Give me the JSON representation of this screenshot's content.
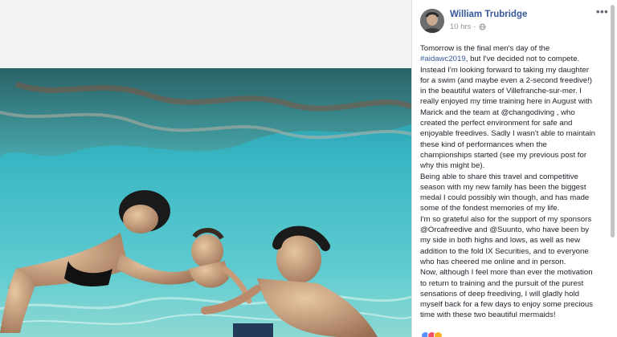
{
  "post": {
    "author_name": "William Trubridge",
    "timestamp": "10 hrs",
    "separator": "·",
    "hashtag": "#aidawc2019",
    "lines": [
      "Tomorrow is the final men's day of the",
      ", but I've decided not to compete.",
      "Instead I'm looking forward to taking my daughter",
      "for a swim (and maybe even a 2-second freedive!)",
      "in the beautiful waters of Villefranche-sur-mer. I",
      "really enjoyed my time training here in August with",
      "Marick and the team at @changodiving , who",
      "created the perfect environment for safe and",
      "enjoyable freedives. Sadly I wasn't able to maintain",
      "these kind of performances when the",
      "championships started (see my previous post for",
      "why this might be).",
      "Being able to share this travel and competitive",
      "season with my new family has been the biggest",
      "medal I could possibly win though, and has made",
      "some of the fondest memories of my life.",
      "I'm so grateful also for the support of my sponsors",
      "@Orcafreedive and @Suunto, who have been by",
      "my side in both highs and lows, as well as new",
      "addition to the fold IX Securities, and to everyone",
      "who has cheered me online and in person.",
      "Now, although I feel more than ever the motivation",
      "to return to training and the pursuit of the purest",
      "sensations of deep freediving, I will gladly hold",
      "myself back for a few days to enjoy some precious",
      "time with these two beautiful mermaids!"
    ]
  },
  "icons": {
    "more": "more-options-icon",
    "globe": "globe-icon",
    "avatar": "avatar-photo"
  },
  "colors": {
    "link": "#365899",
    "text": "#1d2129",
    "meta": "#90949c",
    "water": "#2fa7b8"
  }
}
